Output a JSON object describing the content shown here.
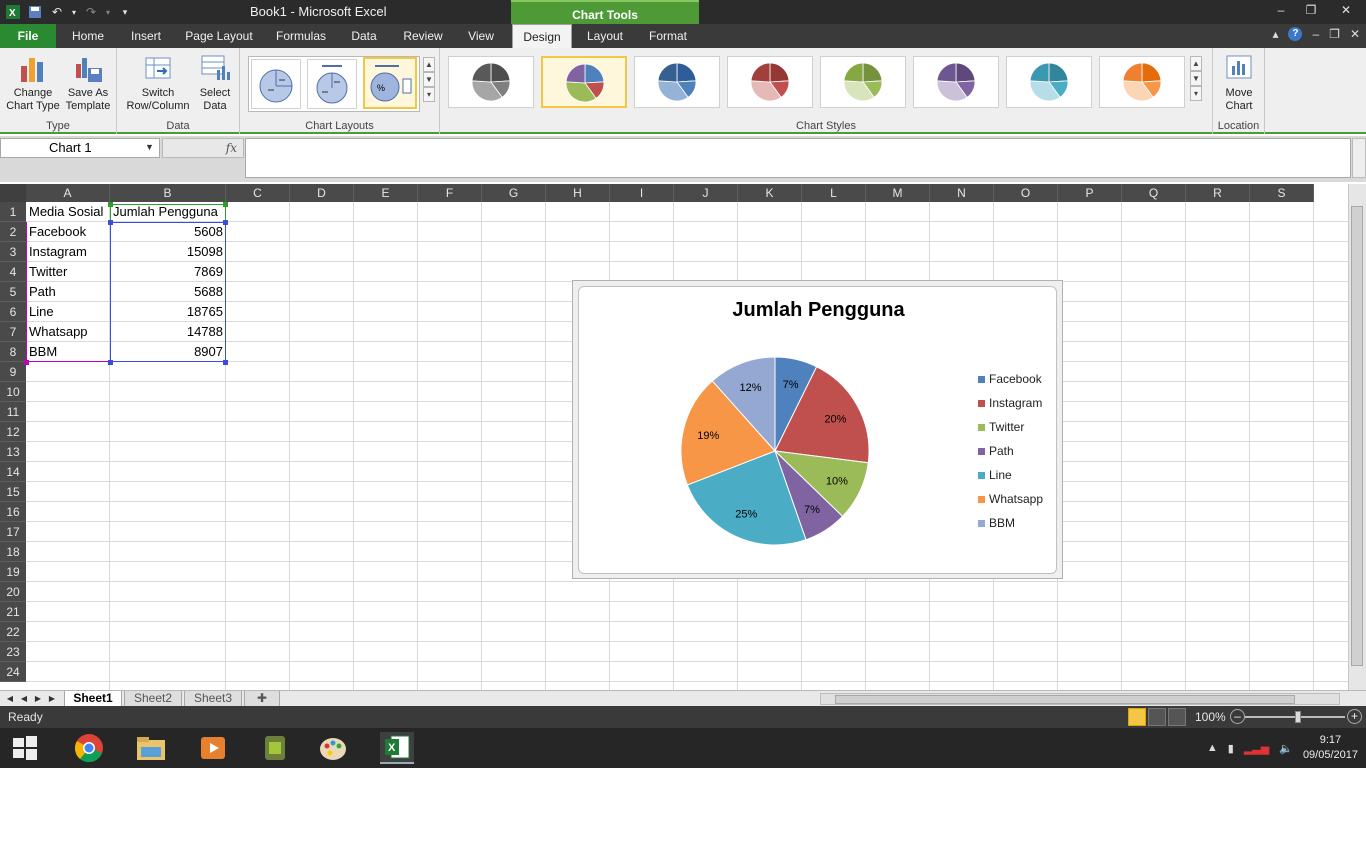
{
  "window": {
    "title": "Book1  -  Microsoft Excel",
    "context_tab": "Chart Tools"
  },
  "tabs": [
    {
      "label": "File"
    },
    {
      "label": "Home"
    },
    {
      "label": "Insert"
    },
    {
      "label": "Page Layout"
    },
    {
      "label": "Formulas"
    },
    {
      "label": "Data"
    },
    {
      "label": "Review"
    },
    {
      "label": "View"
    },
    {
      "label": "Design"
    },
    {
      "label": "Layout"
    },
    {
      "label": "Format"
    }
  ],
  "ribbon": {
    "type_group": {
      "label": "Type",
      "change_chart_type": "Change\nChart Type",
      "save_as_template": "Save As\nTemplate"
    },
    "data_group": {
      "label": "Data",
      "switch_row_column": "Switch\nRow/Column",
      "select_data": "Select\nData"
    },
    "layouts_group": {
      "label": "Chart Layouts",
      "selected_index": 2
    },
    "styles_group": {
      "label": "Chart Styles",
      "selected_index": 1,
      "styles": [
        {
          "colors": [
            "#4d4d4d",
            "#7f7f7f",
            "#a6a6a6",
            "#595959"
          ]
        },
        {
          "colors": [
            "#4f81bd",
            "#c0504d",
            "#9bbb59",
            "#8064a2"
          ]
        },
        {
          "colors": [
            "#2e5d9a",
            "#4f81bd",
            "#95b3d7",
            "#376092"
          ]
        },
        {
          "colors": [
            "#953735",
            "#c0504d",
            "#e6b9b8",
            "#a23e3b"
          ]
        },
        {
          "colors": [
            "#76923c",
            "#9bbb59",
            "#d7e4bc",
            "#86a843"
          ]
        },
        {
          "colors": [
            "#5f497a",
            "#8064a2",
            "#ccc1da",
            "#6e5690"
          ]
        },
        {
          "colors": [
            "#31859c",
            "#4bacc6",
            "#b7dee8",
            "#3c98b1"
          ]
        },
        {
          "colors": [
            "#e46c0a",
            "#f79646",
            "#fcd5b5",
            "#ee8030"
          ]
        }
      ]
    },
    "location_group": {
      "label": "Location",
      "move_chart": "Move\nChart"
    }
  },
  "formula_bar": {
    "name_box": "Chart 1",
    "fx": "fx",
    "formula": ""
  },
  "columns": [
    "A",
    "B",
    "C",
    "D",
    "E",
    "F",
    "G",
    "H",
    "I",
    "J",
    "K",
    "L",
    "M",
    "N",
    "O",
    "P",
    "Q",
    "R",
    "S"
  ],
  "row_numbers": [
    "1",
    "2",
    "3",
    "4",
    "5",
    "6",
    "7",
    "8",
    "9",
    "10",
    "11",
    "12",
    "13",
    "14",
    "15",
    "16",
    "17",
    "18",
    "19",
    "20",
    "21",
    "22",
    "23",
    "24"
  ],
  "sheet_cells": {
    "headers": [
      "Media Sosial",
      "Jumlah Pengguna"
    ],
    "rows": [
      {
        "media": "Facebook",
        "users": "5608"
      },
      {
        "media": "Instagram",
        "users": "15098"
      },
      {
        "media": "Twitter",
        "users": "7869"
      },
      {
        "media": "Path",
        "users": "5688"
      },
      {
        "media": "Line",
        "users": "18765"
      },
      {
        "media": "Whatsapp",
        "users": "14788"
      },
      {
        "media": "BBM",
        "users": "8907"
      }
    ]
  },
  "chart_data": {
    "type": "pie",
    "title": "Jumlah Pengguna",
    "categories": [
      "Facebook",
      "Instagram",
      "Twitter",
      "Path",
      "Line",
      "Whatsapp",
      "BBM"
    ],
    "values": [
      5608,
      15098,
      7869,
      5688,
      18765,
      14788,
      8907
    ],
    "data_labels": [
      "7%",
      "20%",
      "10%",
      "7%",
      "25%",
      "19%",
      "12%"
    ],
    "colors": [
      "#4f81bd",
      "#c0504d",
      "#9bbb59",
      "#8064a2",
      "#4bacc6",
      "#f79646",
      "#95a8d2"
    ],
    "legend_position": "right"
  },
  "sheets": [
    {
      "label": "Sheet1",
      "active": true
    },
    {
      "label": "Sheet2",
      "active": false
    },
    {
      "label": "Sheet3",
      "active": false
    }
  ],
  "status": {
    "ready": "Ready",
    "zoom": "100%",
    "zoom_percent": 100
  },
  "taskbar": {
    "time": "9:17",
    "date": "09/05/2017"
  }
}
